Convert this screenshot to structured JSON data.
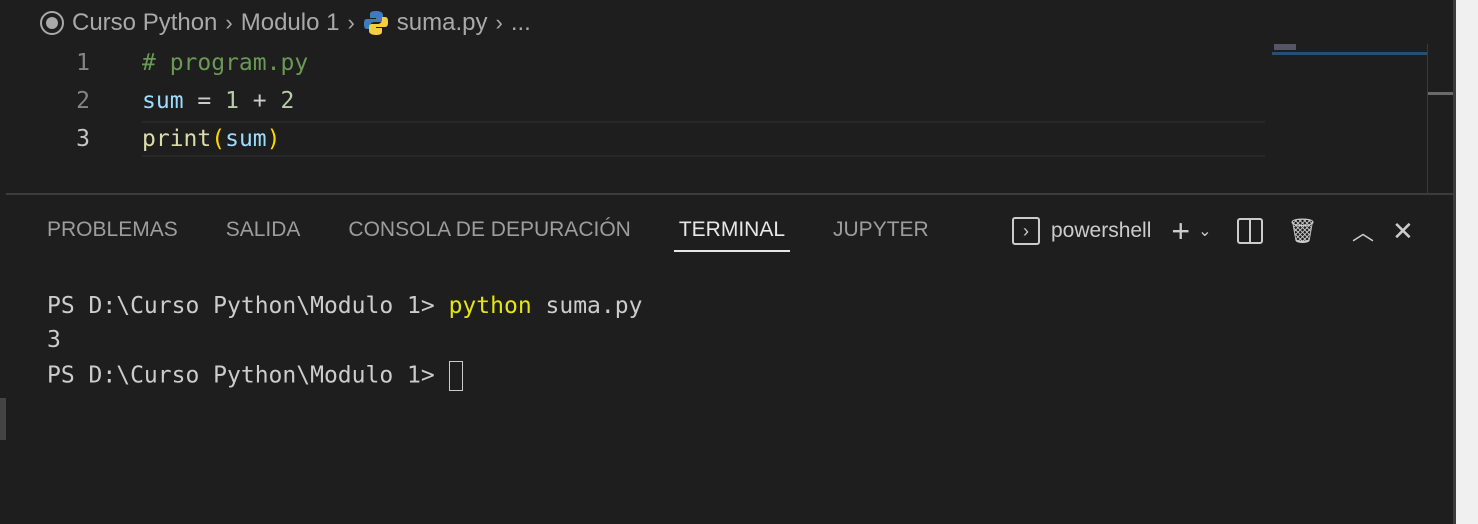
{
  "breadcrumb": {
    "items": [
      "Curso Python",
      "Modulo 1",
      "suma.py",
      "..."
    ]
  },
  "editor": {
    "lines": [
      {
        "num": "1",
        "text": "# program.py"
      },
      {
        "num": "2",
        "var": "sum",
        "op": " = ",
        "a": "1",
        "plus": " + ",
        "b": "2"
      },
      {
        "num": "3",
        "fn": "print",
        "open": "(",
        "arg": "sum",
        "close": ")"
      }
    ]
  },
  "panel": {
    "tabs": [
      "PROBLEMAS",
      "SALIDA",
      "CONSOLA DE DEPURACIÓN",
      "TERMINAL",
      "JUPYTER"
    ],
    "active": "TERMINAL",
    "shell": "powershell"
  },
  "terminal": {
    "prompt": "PS D:\\Curso Python\\Modulo 1> ",
    "cmd": "python",
    "args": " suma.py",
    "output": "3"
  },
  "colors": {
    "comment": "#6a9955",
    "variable": "#9cdcfe",
    "number": "#b5cea8",
    "function": "#dcdcaa",
    "command": "#e5e510"
  }
}
